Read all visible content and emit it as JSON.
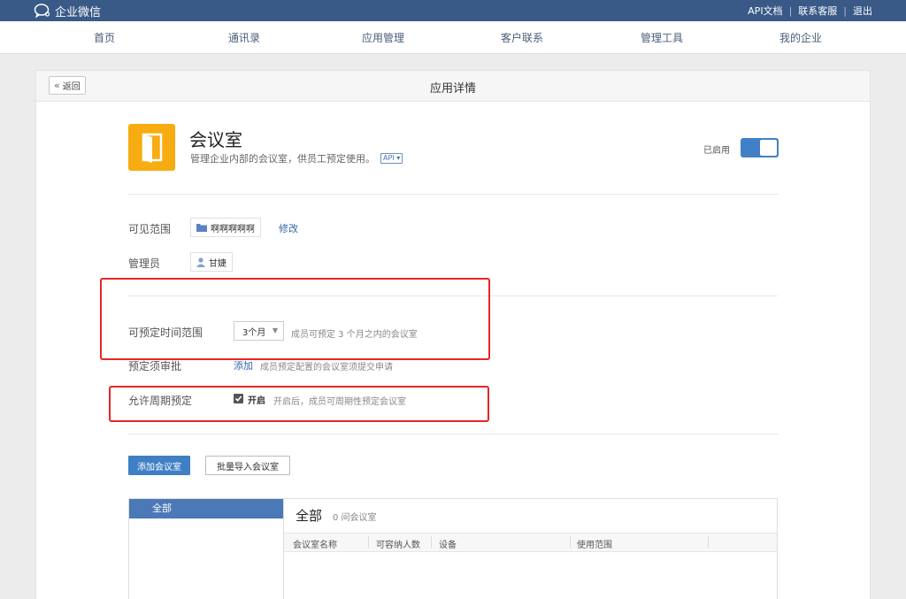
{
  "topbar": {
    "brand": "企业微信",
    "links": [
      "API文档",
      "联系客服",
      "退出"
    ]
  },
  "nav": {
    "items": [
      "首页",
      "通讯录",
      "应用管理",
      "客户联系",
      "管理工具",
      "我的企业"
    ]
  },
  "page": {
    "back_label": "返回",
    "title": "应用详情"
  },
  "app": {
    "name": "会议室",
    "description": "管理企业内部的会议室，供员工预定使用。",
    "api_badge": "API",
    "status_label": "已启用",
    "enabled": true,
    "icon_color": "#f7ac12"
  },
  "settings": {
    "visibility_label": "可见范围",
    "visibility_value": "啊啊啊啊啊",
    "modify_label": "修改",
    "admin_label": "管理员",
    "admin_value": "甘婕",
    "time_range_label": "可预定时间范围",
    "time_range_value": "3个月",
    "time_range_hint": "成员可预定 3 个月之内的会议室",
    "approval_label": "预定须审批",
    "approval_action": "添加",
    "approval_hint": "成员预定配置的会议室须提交申请",
    "recurring_label": "允许周期预定",
    "recurring_checkbox_label": "开启",
    "recurring_hint": "开启后，成员可周期性预定会议室",
    "recurring_checked": true
  },
  "actions": {
    "add_room": "添加会议室",
    "batch_import": "批量导入会议室"
  },
  "rooms": {
    "sidebar_active": "全部",
    "heading": "全部",
    "count_text": "0 间会议室",
    "columns": [
      "会议室名称",
      "可容纳人数",
      "设备",
      "使用范围"
    ]
  },
  "colors": {
    "topbar": "#395987",
    "accent": "#3f7fc5",
    "highlight": "#e42727"
  }
}
